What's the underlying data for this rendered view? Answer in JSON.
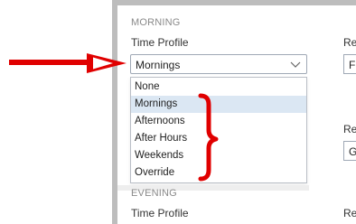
{
  "sections": {
    "morning": {
      "heading": "MORNING",
      "time_profile_label": "Time Profile"
    },
    "evening": {
      "heading": "EVENING",
      "time_profile_label": "Time Profile"
    }
  },
  "time_profile_select": {
    "value": "Mornings",
    "options": [
      "None",
      "Mornings",
      "Afternoons",
      "After Hours",
      "Weekends",
      "Override"
    ],
    "selected_index": 1
  },
  "right_column": {
    "label_top": "Re",
    "field_top_value": "F",
    "label_mid": "Re",
    "field_mid_value": "G",
    "label_bottom": "Re"
  },
  "annotations": {
    "arrow_color": "#e00000",
    "brace_color": "#e00000"
  }
}
